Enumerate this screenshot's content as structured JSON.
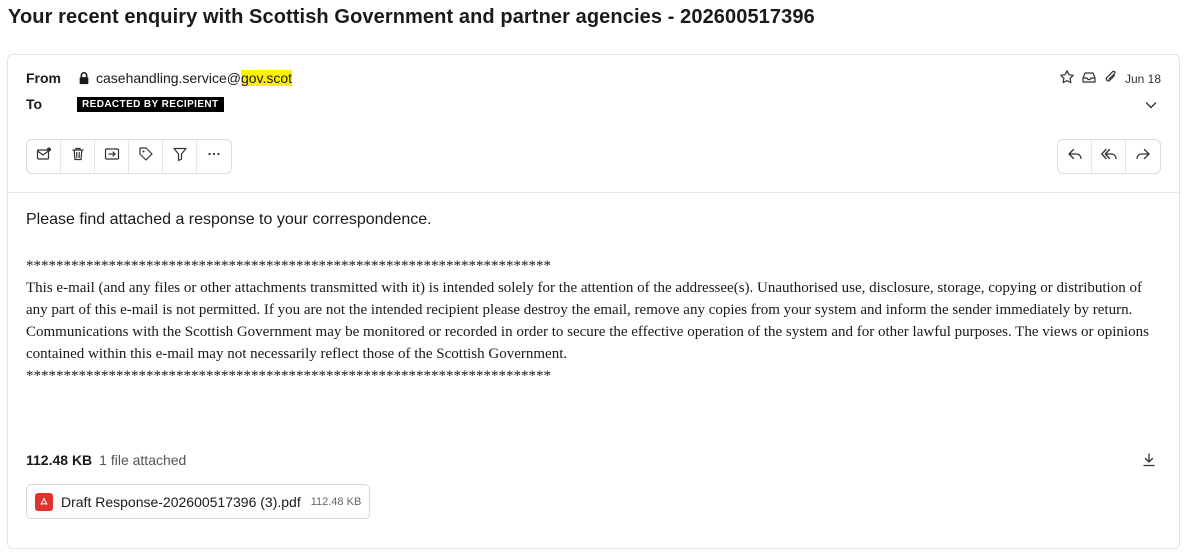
{
  "email": {
    "subject": "Your recent enquiry with Scottish Government and partner agencies - 202600517396",
    "from_label": "From",
    "to_label": "To",
    "sender_local": "casehandling.service@",
    "sender_domain": "gov.scot",
    "recipient_redacted": "REDACTED BY RECIPIENT",
    "date": "Jun 18",
    "greeting": "Please find attached a response to your correspondence.",
    "stars_line": "**********************************************************************",
    "disclaimer": "This e-mail (and any files or other attachments transmitted with it) is intended solely for the attention of the addressee(s). Unauthorised use, disclosure, storage, copying or distribution of any part of this e-mail is not permitted. If you are not the intended recipient please destroy the email, remove any copies from your system and inform the sender immediately by return. Communications with the Scottish Government may be monitored or recorded in order to secure the effective operation of the system and for other lawful purposes. The views or opinions contained within this e-mail may not necessarily reflect those of the Scottish Government."
  },
  "attachments": {
    "total_size": "112.48 KB",
    "count_text": "1 file attached",
    "files": [
      {
        "name": "Draft Response-202600517396 (3).pdf",
        "size": "112.48 KB",
        "icon": "pdf-icon"
      }
    ]
  },
  "toolbar": {
    "left_icons": [
      "mark-unread-icon",
      "trash-icon",
      "move-icon",
      "tag-icon",
      "filter-icon",
      "more-icon"
    ],
    "right_icons": [
      "reply-icon",
      "reply-all-icon",
      "forward-icon"
    ]
  },
  "colors": {
    "highlight": "#fff200",
    "pdf": "#e0332d",
    "border": "#e3e3e3"
  }
}
